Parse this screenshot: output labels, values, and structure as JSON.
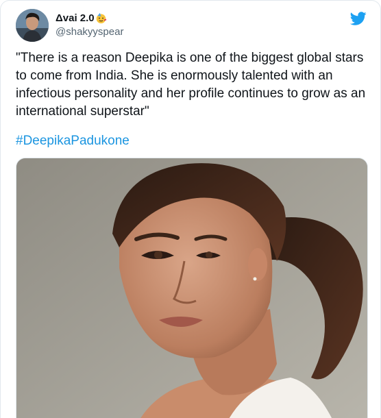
{
  "tweet": {
    "author": {
      "display_name": "Δvai 2.0",
      "emoji": "partying-face-emoji",
      "handle": "@shakyyspear"
    },
    "brand_icon": "twitter-bird-icon",
    "text": "\"There is a reason Deepika is one of the biggest global stars to come from India. She is enormously talented with an infectious personality and her profile continues to grow as an international superstar\"",
    "hashtag": "#DeepikaPadukone",
    "media": {
      "type": "photo"
    }
  },
  "colors": {
    "brand": "#1da1f2",
    "link": "#1b95e0",
    "text": "#0f1419",
    "secondary": "#536471",
    "border": "#e1e8ed"
  }
}
